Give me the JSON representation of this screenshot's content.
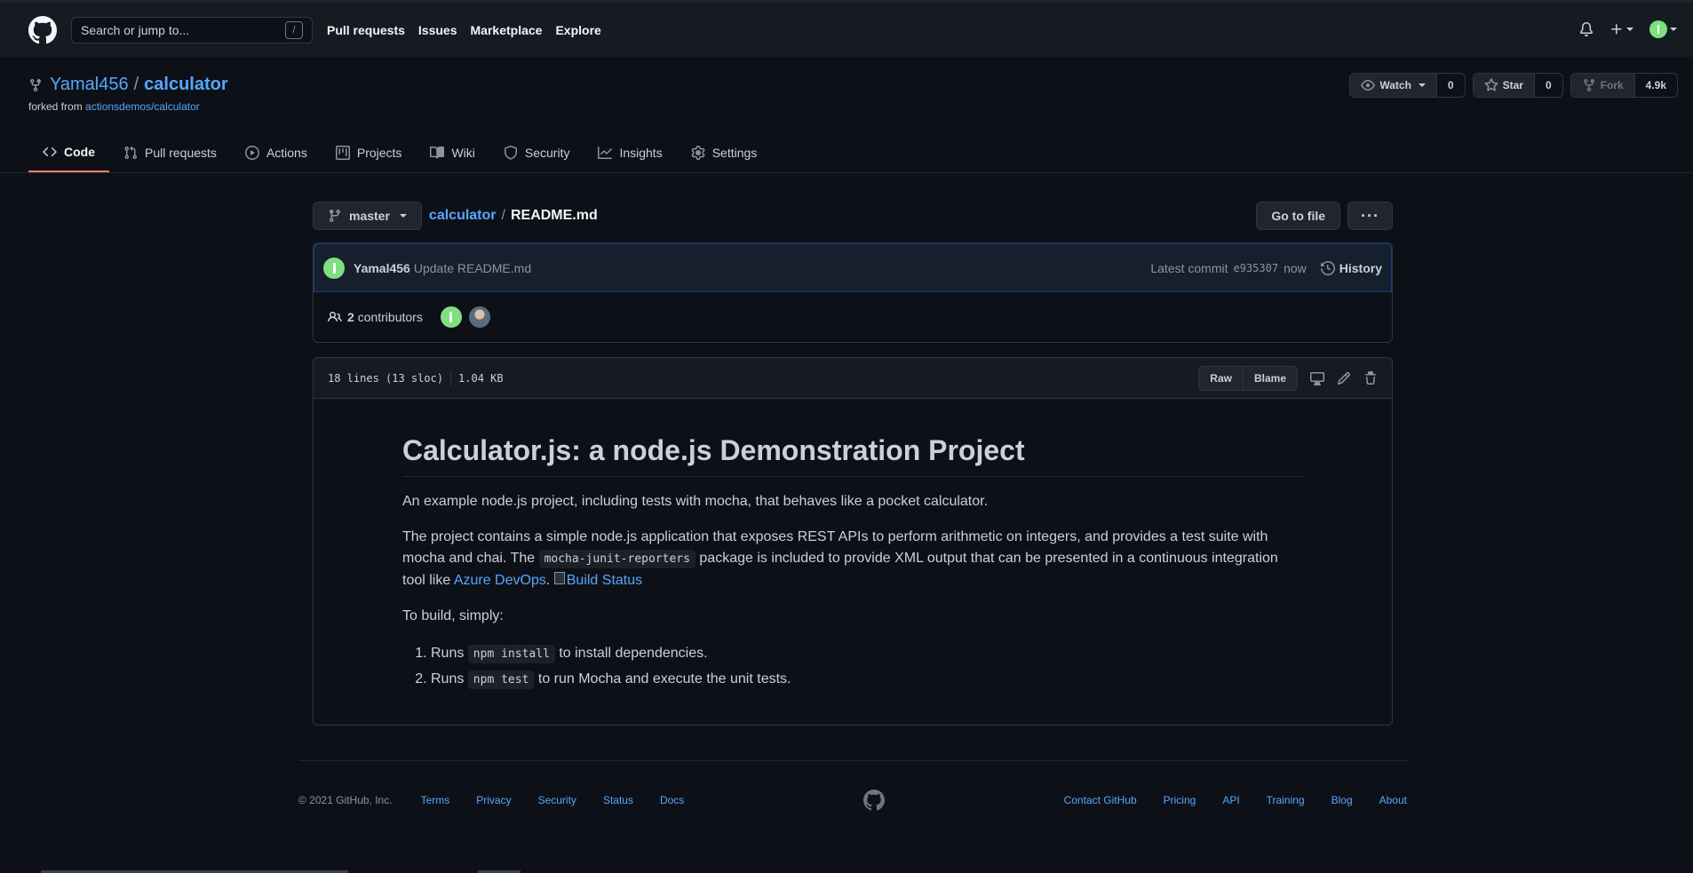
{
  "header": {
    "search_placeholder": "Search or jump to...",
    "search_shortcut": "/",
    "nav": [
      "Pull requests",
      "Issues",
      "Marketplace",
      "Explore"
    ]
  },
  "repo": {
    "owner": "Yamal456",
    "separator": "/",
    "name": "calculator",
    "forked_prefix": "forked from",
    "forked_from": "actionsdemos/calculator",
    "watch": {
      "label": "Watch",
      "count": "0"
    },
    "star": {
      "label": "Star",
      "count": "0"
    },
    "fork": {
      "label": "Fork",
      "count": "4.9k"
    }
  },
  "tabs": [
    {
      "label": "Code",
      "icon": "code-icon",
      "active": true
    },
    {
      "label": "Pull requests",
      "icon": "pull-request-icon"
    },
    {
      "label": "Actions",
      "icon": "play-icon"
    },
    {
      "label": "Projects",
      "icon": "project-icon"
    },
    {
      "label": "Wiki",
      "icon": "book-icon"
    },
    {
      "label": "Security",
      "icon": "shield-icon"
    },
    {
      "label": "Insights",
      "icon": "graph-icon"
    },
    {
      "label": "Settings",
      "icon": "gear-icon"
    }
  ],
  "file_nav": {
    "branch": "master",
    "repo_crumb": "calculator",
    "crumb_sep": "/",
    "file": "README.md",
    "go_to_file": "Go to file",
    "more": "···"
  },
  "commit": {
    "user": "Yamal456",
    "message": "Update README.md",
    "latest_label": "Latest commit",
    "sha": "e935307",
    "time": "now",
    "history": "History"
  },
  "contributors": {
    "count": "2",
    "label": "contributors"
  },
  "file": {
    "lines": "18 lines (13 sloc)",
    "size": "1.04 KB",
    "raw": "Raw",
    "blame": "Blame"
  },
  "readme": {
    "title": "Calculator.js: a node.js Demonstration Project",
    "intro": "An example node.js project, including tests with mocha, that behaves like a pocket calculator.",
    "p2_a": "The project contains a simple node.js application that exposes REST APIs to perform arithmetic on integers, and provides a test suite with mocha and chai. The ",
    "p2_code": "mocha-junit-reporters",
    "p2_b": " package is included to provide XML output that can be presented in a continuous integration tool like ",
    "p2_link": "Azure DevOps",
    "p2_c": ". ",
    "badge_alt": "Build Status",
    "build_intro": "To build, simply:",
    "step1_a": "Runs ",
    "step1_code": "npm install",
    "step1_b": " to install dependencies.",
    "step2_a": "Runs ",
    "step2_code": "npm test",
    "step2_b": " to run Mocha and execute the unit tests."
  },
  "footer": {
    "copyright": "© 2021 GitHub, Inc.",
    "left_links": [
      "Terms",
      "Privacy",
      "Security",
      "Status",
      "Docs"
    ],
    "right_links": [
      "Contact GitHub",
      "Pricing",
      "API",
      "Training",
      "Blog",
      "About"
    ]
  }
}
